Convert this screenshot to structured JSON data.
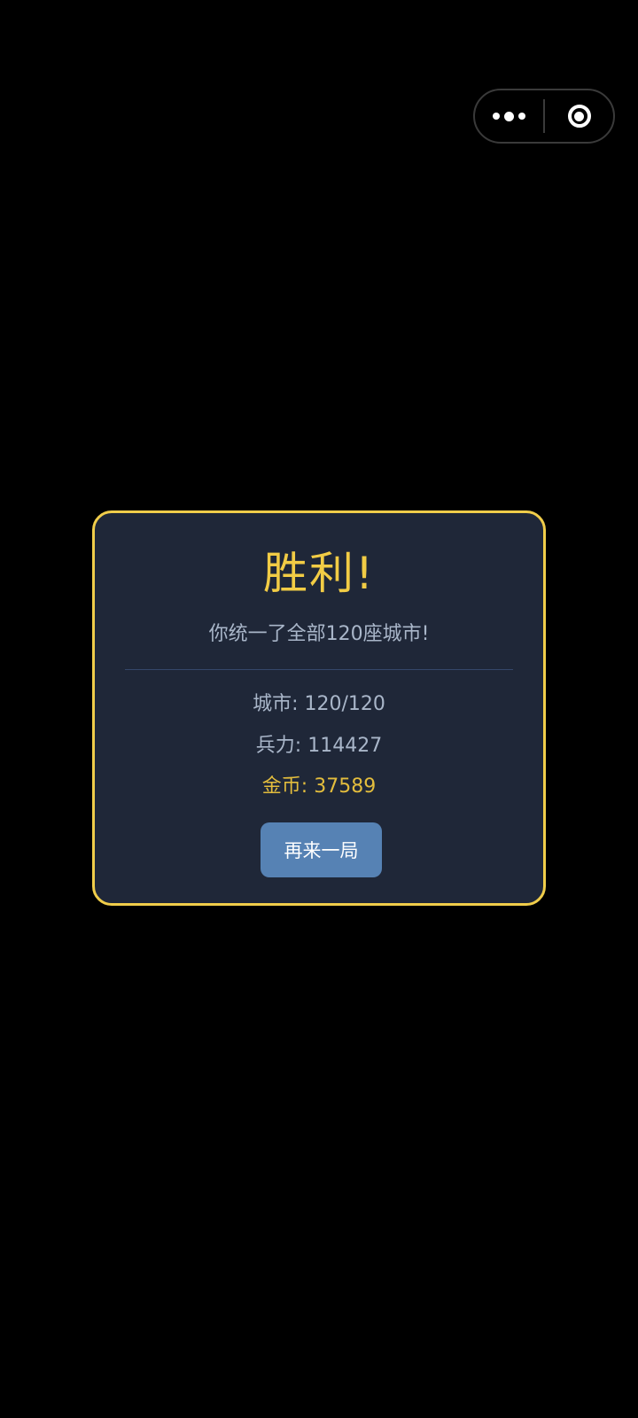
{
  "capsule": {
    "more_icon": "more-dots-icon",
    "close_icon": "target-circle-icon"
  },
  "dialog": {
    "title": "胜利!",
    "subtitle": "你统一了全部120座城市!",
    "stats": {
      "cities": "城市: 120/120",
      "troops": "兵力: 114427",
      "gold": "金币: 37589"
    },
    "replay_label": "再来一局"
  },
  "colors": {
    "background": "#000000",
    "dialog_bg": "#1f2738",
    "dialog_border": "#f0cd4a",
    "title": "#f2cc45",
    "text": "#a9b6c9",
    "gold_text": "#e3bd3d",
    "button_bg": "#5682b4"
  }
}
